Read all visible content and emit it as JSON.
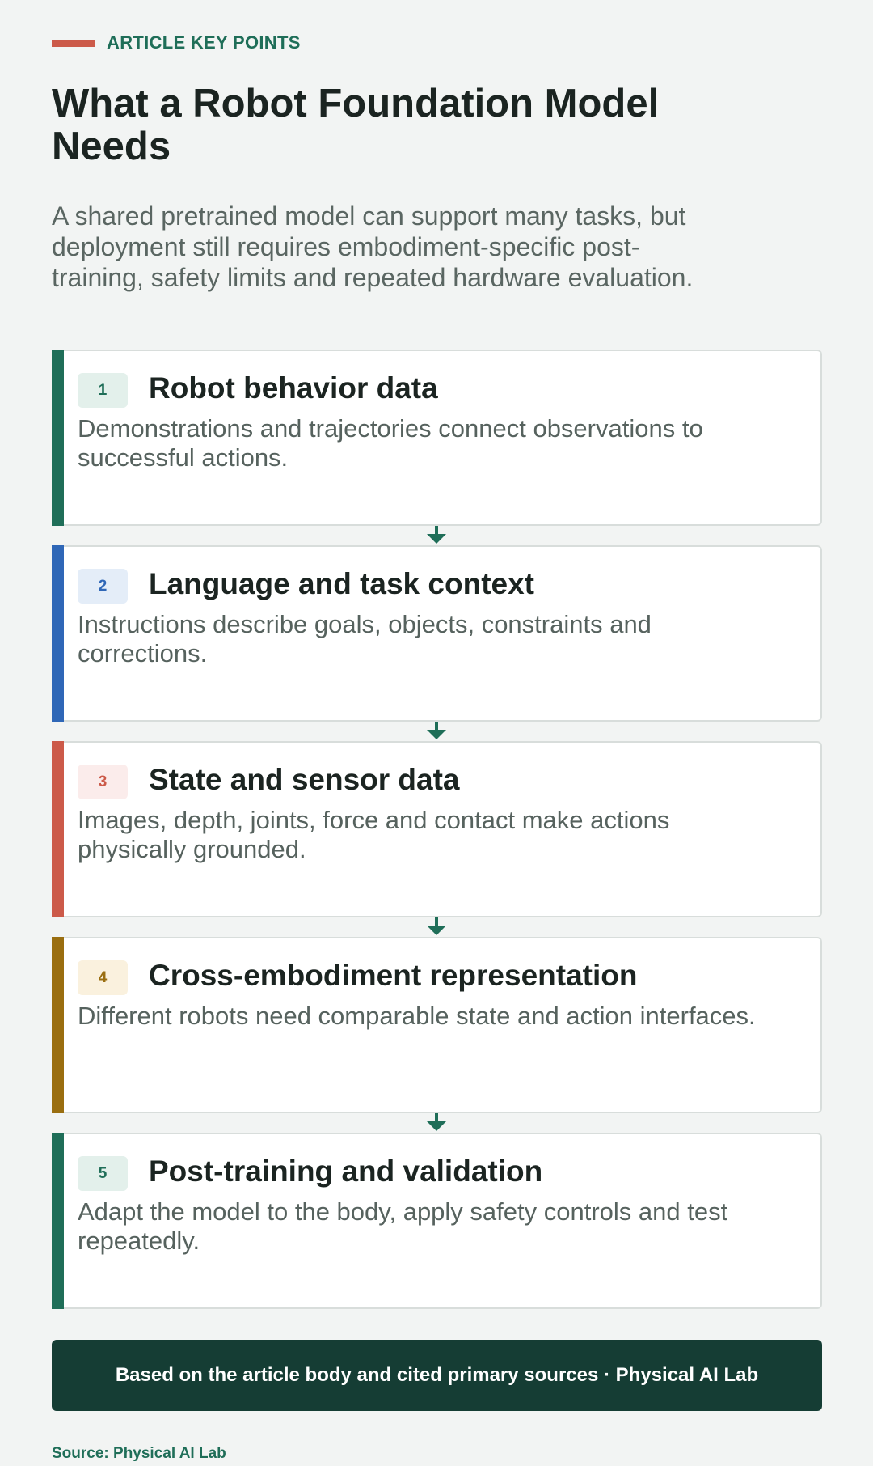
{
  "eyebrow": "ARTICLE KEY POINTS",
  "title": "What a Robot Foundation Model Needs",
  "intro": "A shared pretrained model can support many tasks, but deployment still requires embodiment-specific post-training, safety limits and repeated hardware evaluation.",
  "steps": [
    {
      "number": "1",
      "title": "Robot behavior data",
      "description": "Demonstrations and trajectories connect observations to successful actions.",
      "accent": "#1f6e58",
      "badge_bg": "#e3f0eb",
      "badge_fg": "#1f6e58"
    },
    {
      "number": "2",
      "title": "Language and task context",
      "description": "Instructions describe goals, objects, constraints and corrections.",
      "accent": "#2f67b7",
      "badge_bg": "#e4edf8",
      "badge_fg": "#2f67b7"
    },
    {
      "number": "3",
      "title": "State and sensor data",
      "description": "Images, depth, joints, force and contact make actions physically grounded.",
      "accent": "#cc5a49",
      "badge_bg": "#fbeceb",
      "badge_fg": "#cc5a49"
    },
    {
      "number": "4",
      "title": "Cross-embodiment representation",
      "description": "Different robots need comparable state and action interfaces.",
      "accent": "#9a6e10",
      "badge_bg": "#faf1de",
      "badge_fg": "#9a6e10"
    },
    {
      "number": "5",
      "title": "Post-training and validation",
      "description": "Adapt the model to the body, apply safety controls and test repeatedly.",
      "accent": "#1f6e58",
      "badge_bg": "#e3f0eb",
      "badge_fg": "#1f6e58"
    }
  ],
  "footer": "Based on the article body and cited primary sources · Physical AI Lab",
  "source": "Source: Physical AI Lab",
  "colors": {
    "arrow": "#1f6e58",
    "footer_bg": "#153d34"
  }
}
